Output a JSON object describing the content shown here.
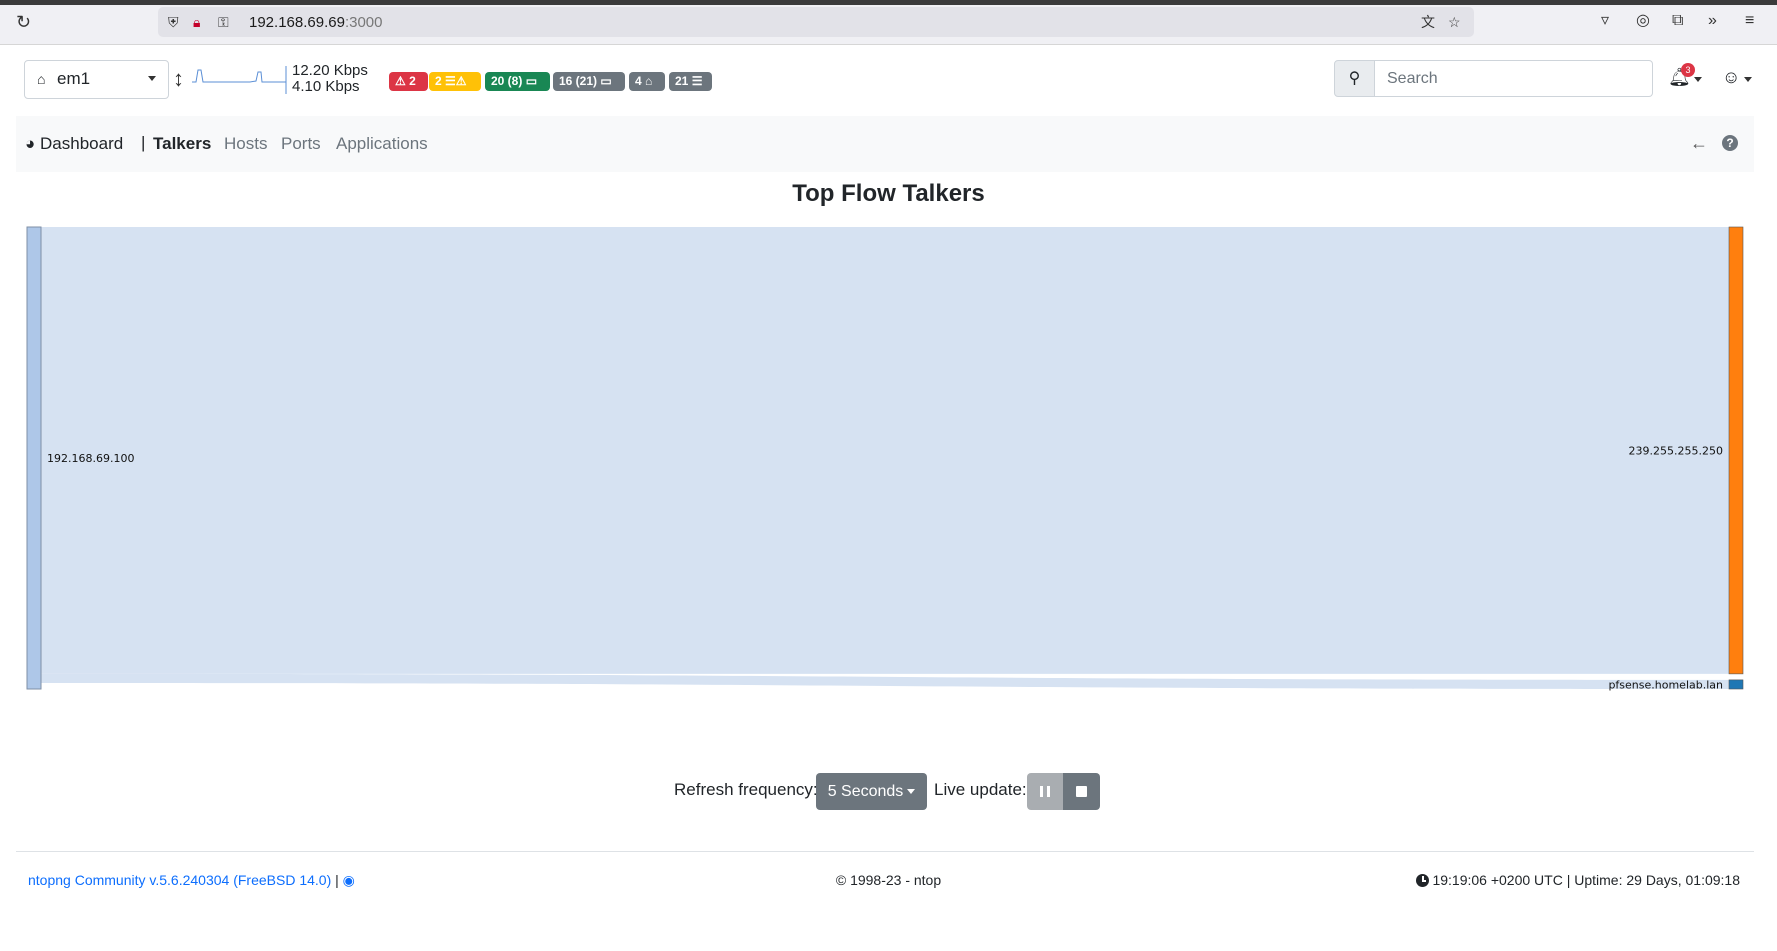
{
  "browser": {
    "url_host": "192.168.69.69",
    "url_port": ":3000"
  },
  "header": {
    "interface_name": "em1",
    "rate_in": "12.20 Kbps",
    "rate_out": "4.10 Kbps",
    "badges": {
      "alerts": "2",
      "warnings": "2",
      "local_hosts": "20 (8)",
      "remote_hosts": "16 (21)",
      "devices": "4",
      "flows": "21"
    },
    "search_placeholder": "Search",
    "notification_count": "3"
  },
  "nav": {
    "dashboard": "Dashboard",
    "separator": "|",
    "tabs": [
      {
        "label": "Talkers",
        "active": true
      },
      {
        "label": "Hosts",
        "active": false
      },
      {
        "label": "Ports",
        "active": false
      },
      {
        "label": "Applications",
        "active": false
      }
    ]
  },
  "chart_data": {
    "type": "sankey",
    "title": "Top Flow Talkers",
    "nodes": [
      {
        "name": "192.168.69.100",
        "side": "left",
        "color": "#aec7e8"
      },
      {
        "name": "239.255.255.250",
        "side": "right",
        "color": "#ff7f0e"
      },
      {
        "name": "pfsense.homelab.lan",
        "side": "right",
        "color": "#1f77b4"
      }
    ],
    "links": [
      {
        "source": "192.168.69.100",
        "target": "239.255.255.250",
        "share": 0.98
      },
      {
        "source": "192.168.69.100",
        "target": "pfsense.homelab.lan",
        "share": 0.02
      }
    ],
    "link_color": "#d6e2f2"
  },
  "controls": {
    "refresh_label": "Refresh frequency:",
    "refresh_value": "5 Seconds",
    "live_update_label": "Live update:"
  },
  "footer": {
    "version": "ntopng Community v.5.6.240304 (FreeBSD 14.0)",
    "separator": "|",
    "copyright": "© 1998-23 - ntop",
    "status": "19:19:06 +0200 UTC | Uptime: 29 Days, 01:09:18"
  },
  "colors": {
    "danger": "#dc3545",
    "warning": "#ffc107",
    "success": "#198754",
    "secondary": "#6c757d",
    "link": "#0d6efd"
  }
}
